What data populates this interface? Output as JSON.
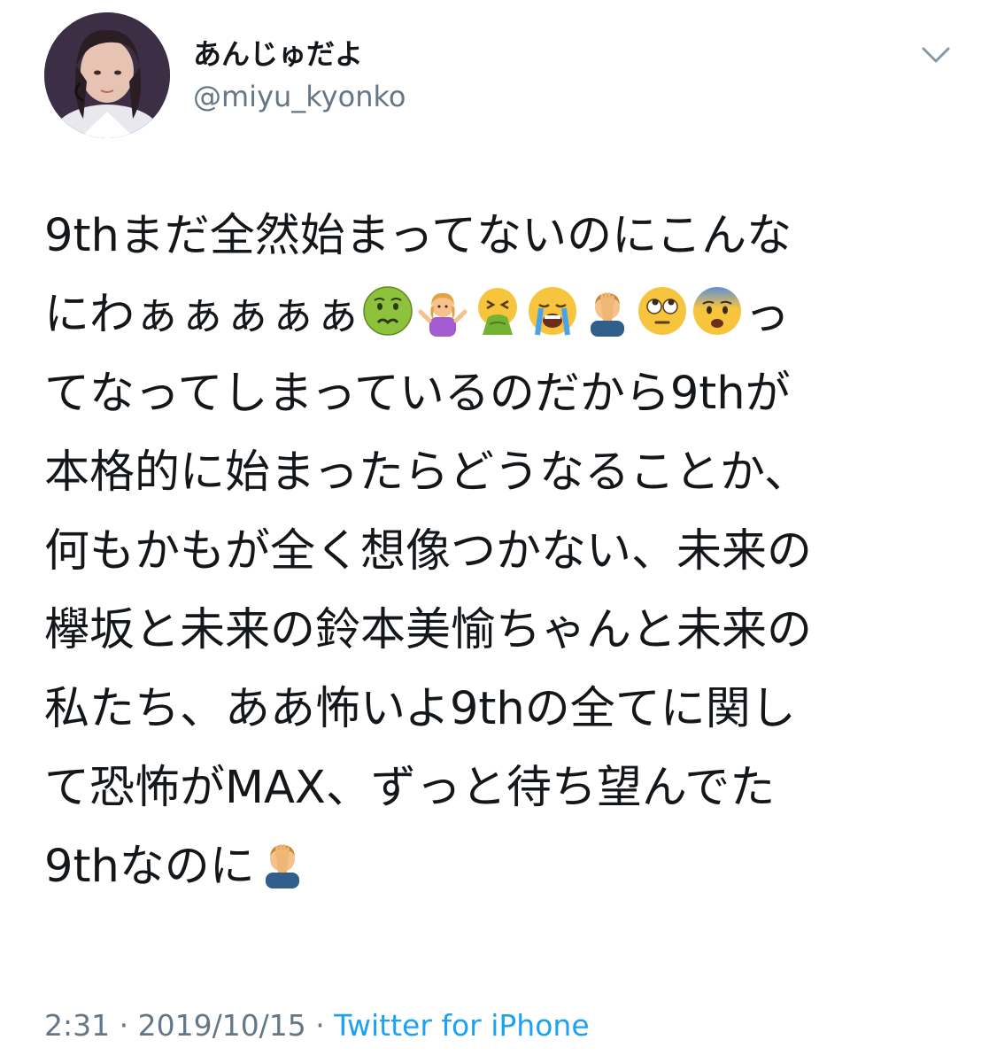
{
  "author": {
    "display_name": "あんじゅだよ",
    "handle": "@miyu_kyonko"
  },
  "tweet": {
    "line1": "9thまだ全然始まってないのにこんな",
    "line2_text": "にわぁぁぁぁぁ",
    "line2_emojis": [
      "nauseated-face",
      "woman-shrugging",
      "face-vomiting",
      "loudly-crying-face",
      "man-facepalming",
      "face-with-rolling-eyes",
      "fearful-face"
    ],
    "line2_tail": "っ",
    "line3": "てなってしまっているのだから9thが",
    "line4": "本格的に始まったらどうなることか、",
    "line5": "何もかもが全く想像つかない、未来の",
    "line6": "欅坂と未来の鈴本美愉ちゃんと未来の",
    "line7": "私たち、ああ怖いよ9thの全てに関し",
    "line8": "て恐怖がMAX、ずっと待ち望んでた",
    "line9_text": "9thなのに",
    "line9_emoji": "man-facepalming"
  },
  "meta": {
    "time": "2:31",
    "separator1": " · ",
    "date": "2019/10/15",
    "separator2": " · ",
    "source": "Twitter for iPhone"
  },
  "icons": {
    "menu": "chevron-down-icon"
  },
  "colors": {
    "text": "#14171a",
    "secondary": "#657786",
    "link": "#1da1f2"
  }
}
